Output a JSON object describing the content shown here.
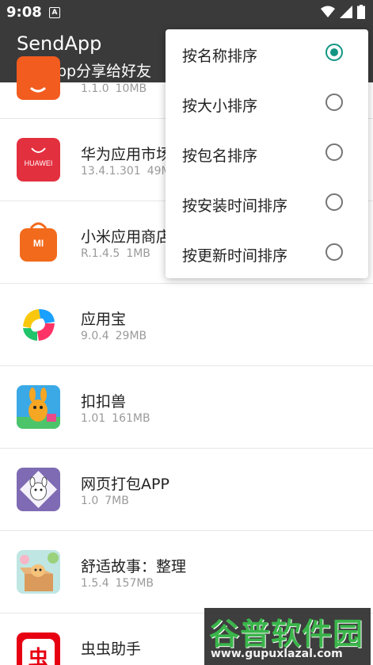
{
  "status_bar": {
    "time": "9:08",
    "notification_glyph": "A",
    "icons": [
      "wifi-icon",
      "signal-icon",
      "battery-icon"
    ]
  },
  "app_bar": {
    "title": "SendApp",
    "subtitle": "选择App分享给好友"
  },
  "apps": [
    {
      "name": "",
      "version": "1.1.0",
      "size": "10MB",
      "icon": "orange-app-icon"
    },
    {
      "name": "华为应用市场",
      "version": "13.4.1.301",
      "size": "49MB",
      "icon": "huawei-appgallery-icon",
      "icon_text": "HUAWEI"
    },
    {
      "name": "小米应用商店",
      "version": "R.1.4.5",
      "size": "1MB",
      "icon": "xiaomi-store-icon",
      "icon_text": "MI"
    },
    {
      "name": "应用宝",
      "version": "9.0.4",
      "size": "29MB",
      "icon": "yingyongbao-icon"
    },
    {
      "name": "扣扣兽",
      "version": "1.01",
      "size": "161MB",
      "icon": "koukoushou-icon"
    },
    {
      "name": "网页打包APP",
      "version": "1.0",
      "size": "7MB",
      "icon": "web-pack-icon"
    },
    {
      "name": "舒适故事：整理",
      "version": "1.5.4",
      "size": "157MB",
      "icon": "cozy-story-icon"
    },
    {
      "name": "虫虫助手",
      "version": "",
      "size": "",
      "icon": "chongchong-icon",
      "icon_text": "虫"
    }
  ],
  "sort_menu": {
    "items": [
      {
        "label": "按名称排序",
        "checked": true
      },
      {
        "label": "按大小排序",
        "checked": false
      },
      {
        "label": "按包名排序",
        "checked": false
      },
      {
        "label": "按安装时间排序",
        "checked": false
      },
      {
        "label": "按更新时间排序",
        "checked": false
      }
    ],
    "accent_color": "#129683"
  },
  "watermark": {
    "text": "谷普软件园",
    "url": "www.gupuxlazal.com"
  },
  "colors": {
    "app_bar": "#3a3a3a",
    "accent": "#129683",
    "meta_text": "#9a9a9a"
  }
}
